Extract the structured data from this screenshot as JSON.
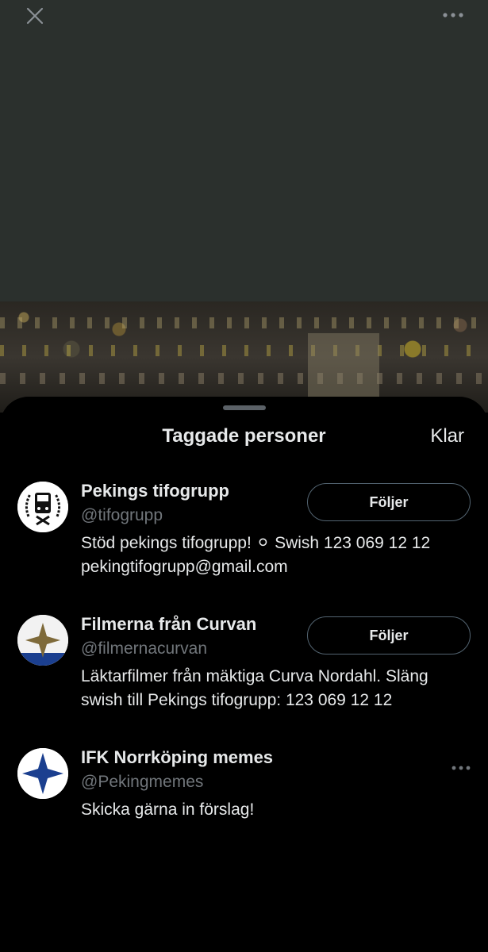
{
  "viewer": {
    "close_icon": "close-icon",
    "more_icon": "more-horizontal-icon"
  },
  "sheet": {
    "title": "Taggade personer",
    "done_label": "Klar"
  },
  "people": [
    {
      "name": "Pekings tifogrupp",
      "handle": "@tifogrupp",
      "bio_line1": "Stöd pekings tifogrupp! ⚪ Swish 123 069 12 12",
      "bio_line2": "pekingtifogrupp@gmail.com",
      "follow_label": "Följer"
    },
    {
      "name": "Filmerna från Curvan",
      "handle": "@filmernacurvan",
      "bio_line1": "Läktarfilmer från mäktiga Curva Nordahl. Släng",
      "bio_line2": "swish till Pekings tifogrupp: 123 069 12 12",
      "follow_label": "Följer"
    },
    {
      "name": "IFK Norrköping memes",
      "handle": "@Pekingmemes",
      "bio_line1": "Skicka gärna in förslag!"
    }
  ],
  "colors": {
    "top_background": "#2b302d",
    "sheet_background": "#000000",
    "primary_text": "#e7e9ea",
    "secondary_text": "#71767b",
    "button_border": "#536471",
    "ifk_blue": "#1b3f8f"
  }
}
